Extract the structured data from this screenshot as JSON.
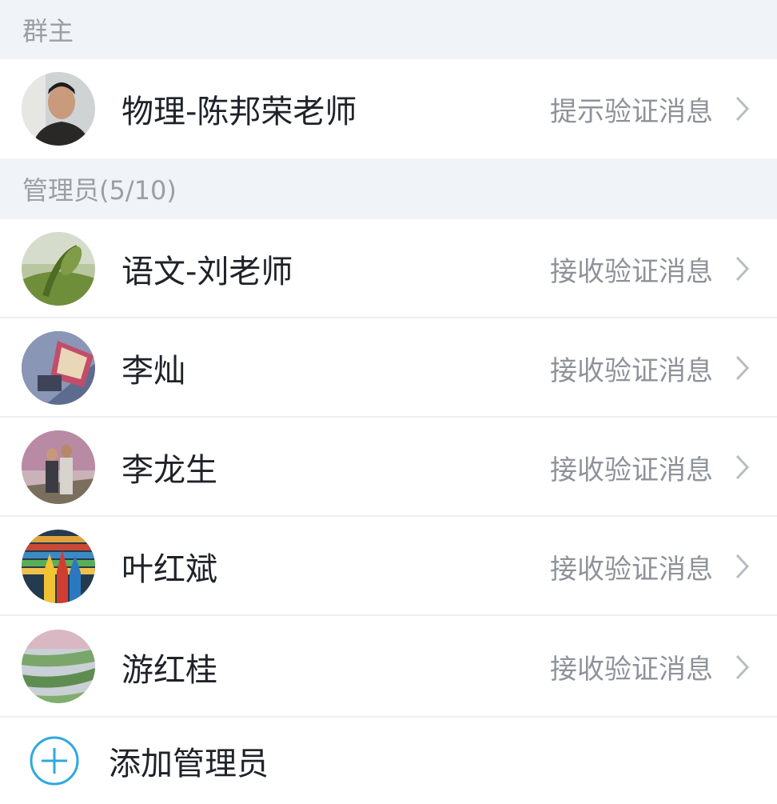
{
  "owner_section": {
    "header": "群主",
    "member": {
      "name": "物理-陈邦荣老师",
      "status": "提示验证消息"
    }
  },
  "admin_section": {
    "header": "管理员(5/10)",
    "members": [
      {
        "name": "语文-刘老师",
        "status": "接收验证消息"
      },
      {
        "name": "李灿",
        "status": "接收验证消息"
      },
      {
        "name": "李龙生",
        "status": "接收验证消息"
      },
      {
        "name": "叶红斌",
        "status": "接收验证消息"
      },
      {
        "name": "游红桂",
        "status": "接收验证消息"
      }
    ]
  },
  "add_admin": {
    "label": "添加管理员"
  },
  "colors": {
    "header_bg": "#f0f3f7",
    "header_text": "#9a9fa6",
    "name_text": "#1f2329",
    "status_text": "#8e939a",
    "accent": "#2fa8df"
  },
  "icons": {
    "chevron": "chevron-right-icon",
    "add": "plus-circle-icon"
  }
}
